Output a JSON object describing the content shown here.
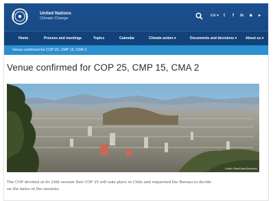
{
  "header": {
    "org_name": "United Nations",
    "org_sub": "Climate Change",
    "language": "EN ▾",
    "social_icons": [
      "twitter-icon",
      "facebook-icon",
      "linkedin-icon",
      "flickr-icon",
      "youtube-icon"
    ],
    "social_glyphs": [
      "t",
      "f",
      "in",
      "◙",
      "▸"
    ]
  },
  "nav": {
    "items": [
      "Home",
      "Process and meetings",
      "Topics",
      "Calendar",
      "Climate action ▾",
      "Documents and decisions ▾",
      "About us ▾"
    ]
  },
  "breadcrumb": "Venue confirmed for COP 25, CMP 15, CMA 2",
  "page_title": "Venue confirmed for COP 25, CMP 15, CMA 2",
  "photo": {
    "credit": "Credit: Flickr/David Berkowitz"
  },
  "body": {
    "text": "The COP decided at its 24th session that COP 25 will take place in Chile and requested the Bureau to decide on the dates of the sessions."
  },
  "colors": {
    "header_blue": "#1b4f8c",
    "nav_blue": "#124279",
    "breadcrumb_blue": "#2c8fd0"
  }
}
